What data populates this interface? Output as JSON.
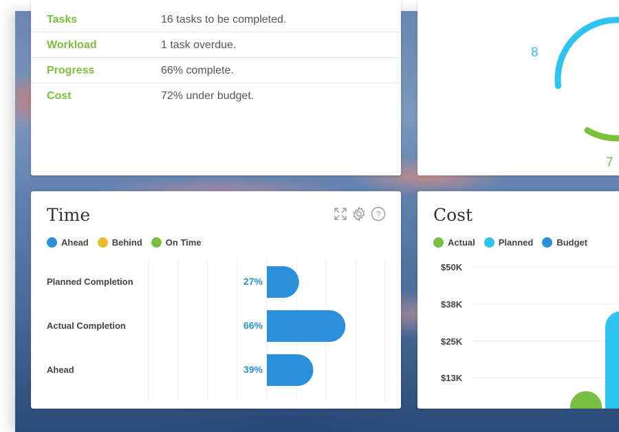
{
  "summary": {
    "rows": [
      {
        "label": "Tasks",
        "value": "16 tasks to be completed."
      },
      {
        "label": "Workload",
        "value": "1 task overdue."
      },
      {
        "label": "Progress",
        "value": "66% complete."
      },
      {
        "label": "Cost",
        "value": "72% under budget."
      }
    ]
  },
  "donut": {
    "label_blue": "8",
    "label_green": "7",
    "colors": {
      "blue": "#2ec4f0",
      "green": "#7cbf3a",
      "gray": "#d9d9d9"
    }
  },
  "time_card": {
    "title": "Time",
    "legend": [
      {
        "label": "Ahead",
        "color": "#2c8fd9"
      },
      {
        "label": "Behind",
        "color": "#e8bd2b"
      },
      {
        "label": "On Time",
        "color": "#78bf43"
      }
    ],
    "tools": {
      "expand_icon": "expand-icon",
      "settings_icon": "gear-icon",
      "help_icon": "help-icon",
      "help_glyph": "?"
    },
    "chart_data": {
      "type": "bar",
      "orientation": "horizontal",
      "categories": [
        "Planned Completion",
        "Actual Completion",
        "Ahead"
      ],
      "values": [
        27,
        66,
        39
      ],
      "value_labels": [
        "27%",
        "66%",
        "39%"
      ],
      "unit": "%",
      "bar_color": "#2c8fd9",
      "grid": true
    }
  },
  "cost_card": {
    "title": "Cost",
    "legend": [
      {
        "label": "Actual",
        "color": "#78bf43"
      },
      {
        "label": "Planned",
        "color": "#2ec4f0"
      },
      {
        "label": "Budget",
        "color": "#2c8fd9"
      }
    ],
    "chart_data": {
      "type": "bar",
      "y_ticks": [
        "$50K",
        "$38K",
        "$25K",
        "$13K"
      ],
      "ylim": [
        0,
        50000
      ],
      "series": [
        {
          "name": "Actual",
          "values": [
            8000
          ]
        },
        {
          "name": "Planned",
          "values": [
            35000
          ]
        }
      ],
      "grid": true
    }
  }
}
